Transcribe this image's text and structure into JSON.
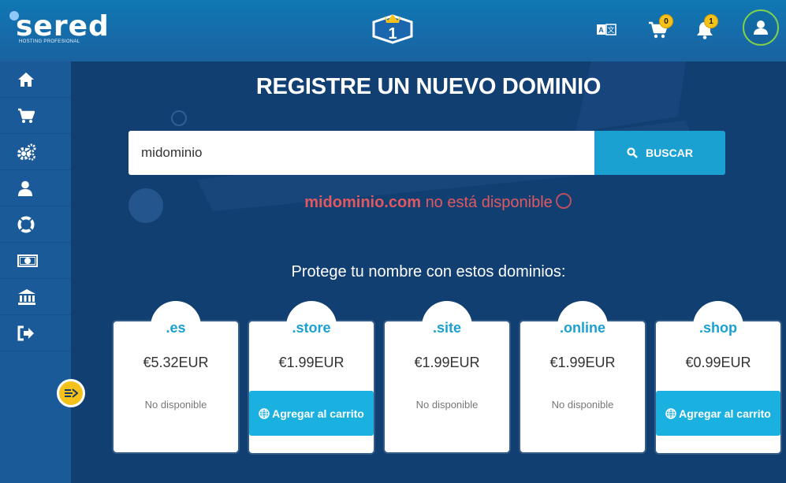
{
  "brand": {
    "name": "sered",
    "tagline": "HOSTING PROFESIONAL",
    "badge_number": "1"
  },
  "header": {
    "cart_count": "0",
    "notifications_count": "1"
  },
  "sidebar": {
    "items": [
      {
        "icon": "home-icon"
      },
      {
        "icon": "cart-icon"
      },
      {
        "icon": "gears-icon"
      },
      {
        "icon": "user-icon"
      },
      {
        "icon": "support-icon"
      },
      {
        "icon": "money-icon"
      },
      {
        "icon": "bank-icon"
      },
      {
        "icon": "logout-icon"
      }
    ]
  },
  "main": {
    "title": "REGISTRE UN NUEVO DOMINIO",
    "search": {
      "value": "midominio",
      "button_label": "BUSCAR"
    },
    "result": {
      "domain": "midominio.com",
      "message": "no está disponible"
    },
    "protect_title": "Protege tu nombre con estos dominios:",
    "suggestions": [
      {
        "tld": ".es",
        "price": "€5.32EUR",
        "status": "No disponible",
        "available": false
      },
      {
        "tld": ".store",
        "price": "€1.99EUR",
        "button": "Agregar al carrito",
        "available": true
      },
      {
        "tld": ".site",
        "price": "€1.99EUR",
        "status": "No disponible",
        "available": false
      },
      {
        "tld": ".online",
        "price": "€1.99EUR",
        "status": "No disponible",
        "available": false
      },
      {
        "tld": ".shop",
        "price": "€0.99EUR",
        "button": "Agregar al carrito",
        "available": true
      }
    ]
  },
  "colors": {
    "header": "#1a62a0",
    "sidebar": "#1a5a98",
    "main_bg": "#123f72",
    "accent": "#1ba0d2",
    "error": "#e05860",
    "badge": "#f4c21b"
  }
}
